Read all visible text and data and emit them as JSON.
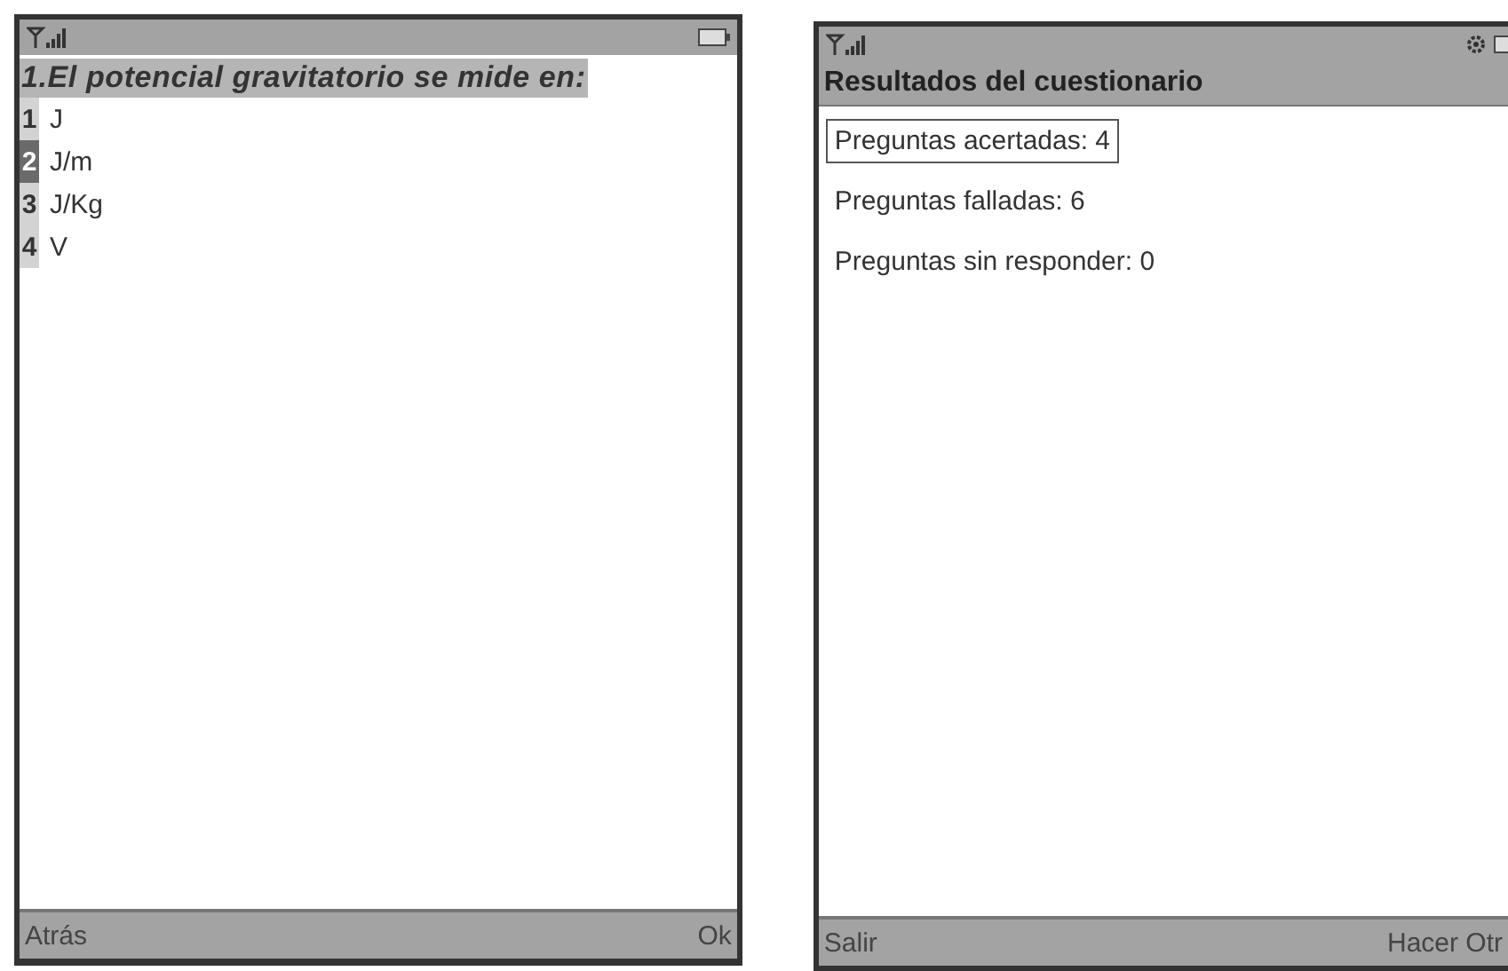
{
  "quiz_screen": {
    "question": "1.El potencial gravitatorio se mide en:",
    "options": [
      {
        "number": "1",
        "label": "J",
        "selected": false
      },
      {
        "number": "2",
        "label": "J/m",
        "selected": true
      },
      {
        "number": "3",
        "label": "J/Kg",
        "selected": false
      },
      {
        "number": "4",
        "label": "V",
        "selected": false
      }
    ],
    "softkeys": {
      "left": "Atrás",
      "right": "Ok"
    }
  },
  "results_screen": {
    "title": "Resultados del cuestionario",
    "items": [
      {
        "label": "Preguntas acertadas: 4",
        "selected": true
      },
      {
        "label": "Preguntas falladas: 6",
        "selected": false
      },
      {
        "label": "Preguntas sin responder: 0",
        "selected": false
      }
    ],
    "softkeys": {
      "left": "Salir",
      "right": "Hacer Otr"
    }
  }
}
